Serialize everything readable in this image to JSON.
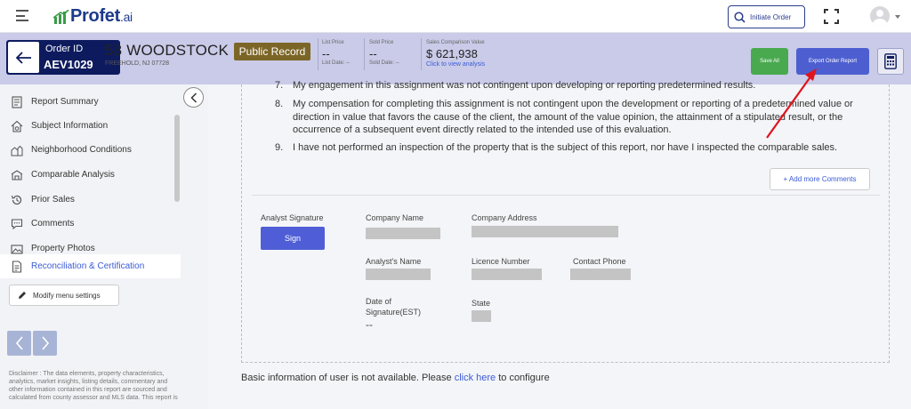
{
  "header": {
    "logo_main": "Profet",
    "logo_suffix": ".ai",
    "initiate_order": "Initiate Order"
  },
  "order": {
    "label": "Order ID",
    "id": "AEV1029",
    "address": "53 WOODSTOCK PL",
    "city": "FREEHOLD, NJ 07728",
    "record_badge": "Public Record",
    "list_price_label": "List Price",
    "list_price_value": "--",
    "list_date_label": "List Date: --",
    "sold_price_label": "Sold Price",
    "sold_price_value": "--",
    "sold_date_label": "Sold Date: --",
    "scp_label": "Sales Comparison Value",
    "scp_value": "$ 621,938",
    "scp_link": "Click to view analysis",
    "save_all": "Save All",
    "export": "Export Order Report"
  },
  "sidebar": {
    "items": [
      {
        "label": "Report Summary",
        "icon": "report-icon"
      },
      {
        "label": "Subject Information",
        "icon": "house-gear-icon"
      },
      {
        "label": "Neighborhood Conditions",
        "icon": "neighborhood-icon"
      },
      {
        "label": "Comparable Analysis",
        "icon": "comparable-icon"
      },
      {
        "label": "Prior Sales",
        "icon": "history-icon"
      },
      {
        "label": "Comments",
        "icon": "comment-icon"
      },
      {
        "label": "Property Photos",
        "icon": "photos-icon"
      },
      {
        "label": "Reconciliation & Certification",
        "icon": "certificate-icon"
      }
    ],
    "modify_menu": "Modify menu settings",
    "disclaimer": "Disclaimer : The data elements, property characteristics, analytics, market insights, listing details, commentary and other information contained in this report are sourced and calculated from county assessor and MLS data. This report is"
  },
  "certification": {
    "items": [
      {
        "num": "7.",
        "text": "My engagement in this assignment was not contingent upon developing or reporting predetermined results."
      },
      {
        "num": "8.",
        "text": "My compensation for completing this assignment is not contingent upon the development or reporting of a predetermined value or direction in value that favors the cause of the client, the amount of the value opinion, the attainment of a stipulated result, or the occurrence of a subsequent event directly related to the intended use of this evaluation."
      },
      {
        "num": "9.",
        "text": "I have not performed an inspection of the property that is the subject of this report, nor have I inspected the comparable sales."
      }
    ],
    "add_comments": "+ Add more Comments"
  },
  "signature": {
    "analyst_signature": "Analyst Signature",
    "sign": "Sign",
    "company_name": "Company Name",
    "company_address": "Company Address",
    "analyst_name": "Analyst's Name",
    "licence_number": "Licence Number",
    "contact_phone": "Contact Phone",
    "date_label_1": "Date of",
    "date_label_2": "Signature(EST)",
    "date_value": "--",
    "state": "State"
  },
  "footer": {
    "basic_pre": "Basic information of user is not available. Please ",
    "basic_link": "click here",
    "basic_post": " to configure"
  },
  "colors": {
    "navy": "#0d1b5e",
    "accent": "#4d5fd0",
    "save_green": "#49a94f",
    "badge_brown": "#7c6627",
    "arrow_red": "#e0141e"
  }
}
